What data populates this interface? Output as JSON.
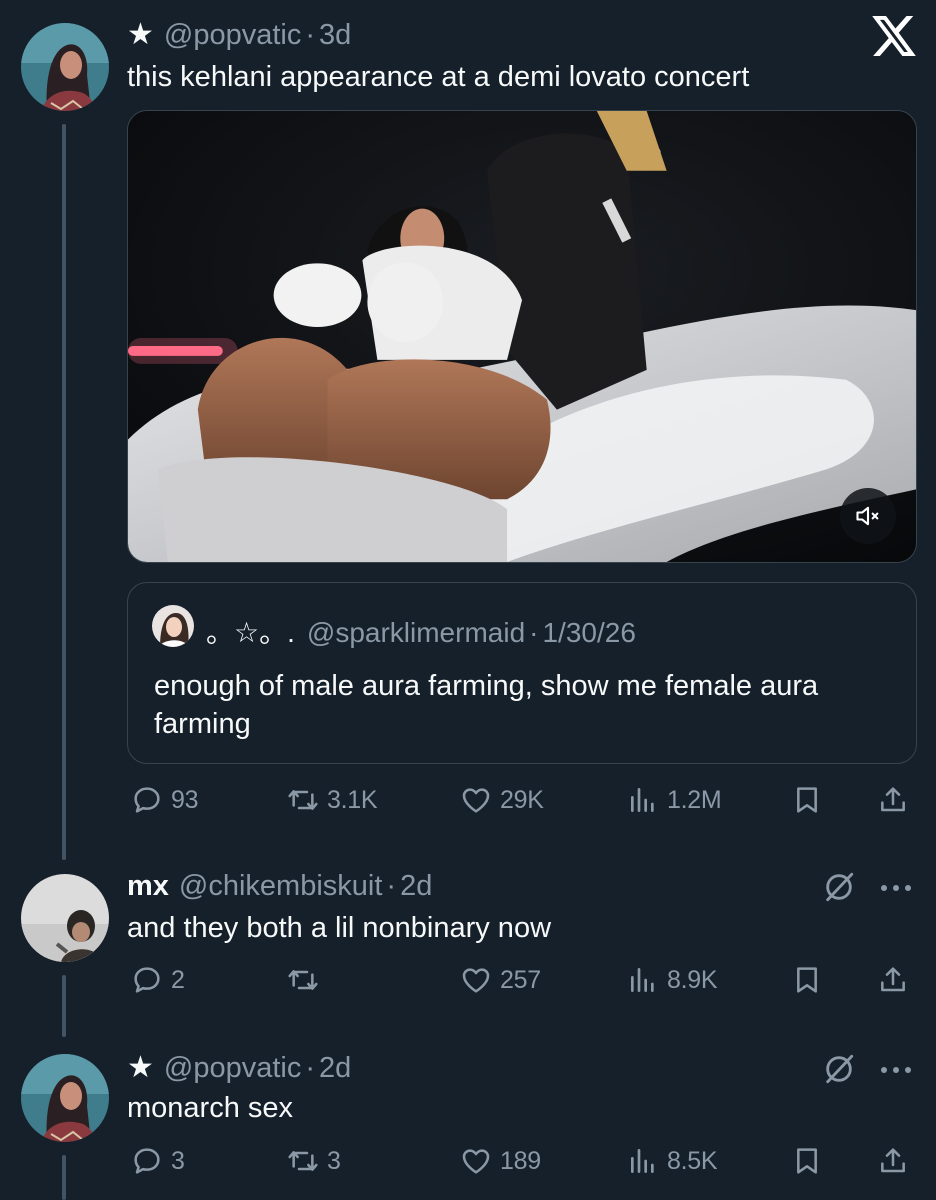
{
  "tweets": [
    {
      "star": "★",
      "name": "",
      "handle": "@popvatic",
      "separator": "·",
      "time": "3d",
      "text": "this kehlani appearance at a demi lovato concert",
      "replies": "93",
      "retweets": "3.1K",
      "likes": "29K",
      "views": "1.2M"
    },
    {
      "star": "",
      "name": "mx",
      "handle": "@chikembiskuit",
      "separator": "·",
      "time": "2d",
      "text": "and they both a lil nonbinary now",
      "replies": "2",
      "retweets": "",
      "likes": "257",
      "views": "8.9K"
    },
    {
      "star": "★",
      "name": "",
      "handle": "@popvatic",
      "separator": "·",
      "time": "2d",
      "text": "monarch sex",
      "replies": "3",
      "retweets": "3",
      "likes": "189",
      "views": "8.5K"
    }
  ],
  "quote": {
    "name": "。☆。.",
    "handle": "@sparklimermaid",
    "separator": "·",
    "time": "1/30/26",
    "text": "enough of male aura farming, show me female aura farming"
  },
  "icons": {
    "logo": "x-logo-icon",
    "reply": "reply-icon",
    "retweet": "retweet-icon",
    "like": "heart-icon",
    "views": "views-icon",
    "bookmark": "bookmark-icon",
    "share": "share-icon",
    "mute": "muted-speaker-icon",
    "more": "more-icon",
    "grok": "grok-icon"
  },
  "colors": {
    "background": "#15202b",
    "text": "#f7f9f9",
    "secondary": "#8b98a5",
    "border": "#38444d",
    "thread_line": "#425364"
  }
}
